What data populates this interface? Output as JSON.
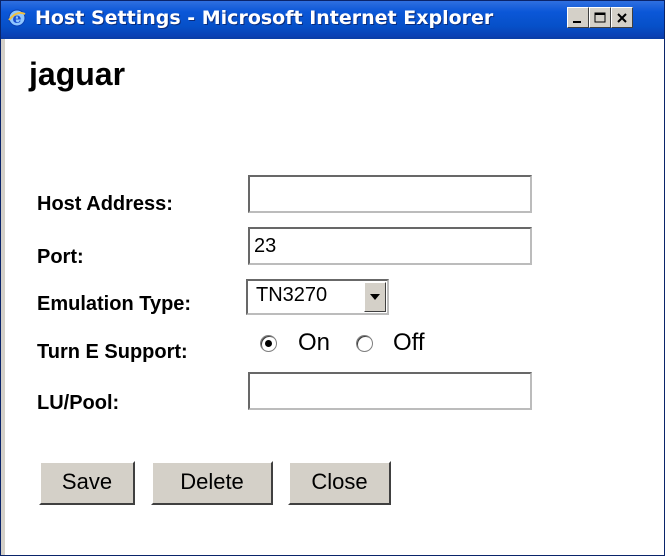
{
  "window": {
    "title": "Host Settings - Microsoft Internet Explorer",
    "icon": "ie-icon",
    "controls": [
      "minimize-icon",
      "maximize-icon",
      "close-icon"
    ]
  },
  "page": {
    "host_name": "jaguar"
  },
  "form": {
    "host_address": {
      "label": "Host Address:",
      "value": ""
    },
    "port": {
      "label": "Port:",
      "value": "23"
    },
    "emulation_type": {
      "label": "Emulation Type:",
      "selected": "TN3270"
    },
    "turn_e_support": {
      "label": "Turn E Support:",
      "options": [
        {
          "label": "On",
          "checked": true
        },
        {
          "label": "Off",
          "checked": false
        }
      ]
    },
    "lu_pool": {
      "label": "LU/Pool:",
      "value": ""
    }
  },
  "buttons": {
    "save": "Save",
    "delete": "Delete",
    "close": "Close"
  }
}
